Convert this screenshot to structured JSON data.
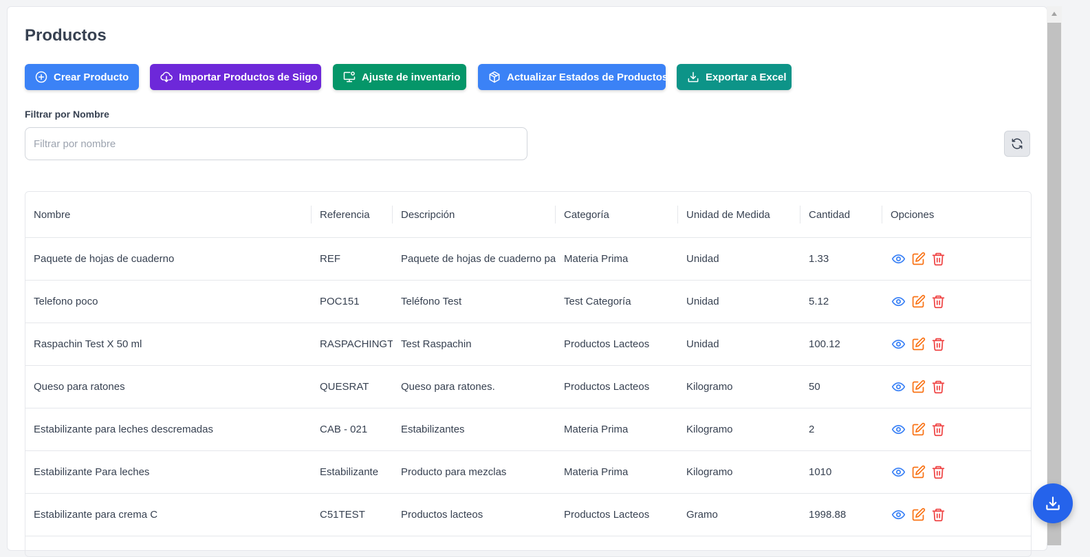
{
  "page": {
    "title": "Productos"
  },
  "toolbar": {
    "buttons": [
      {
        "label": "Crear Producto",
        "icon": "plus-circle-icon",
        "color": "#3b82f6"
      },
      {
        "label": "Importar Productos de Siigo",
        "icon": "cloud-download-icon",
        "color": "#6d28d9"
      },
      {
        "label": "Ajuste de inventario",
        "icon": "monitor-settings-icon",
        "color": "#059669"
      },
      {
        "label": "Actualizar Estados de Productos",
        "icon": "package-icon",
        "color": "#3b82f6"
      },
      {
        "label": "Exportar a Excel",
        "icon": "download-icon",
        "color": "#0d9488"
      }
    ]
  },
  "filter": {
    "label": "Filtrar por Nombre",
    "placeholder": "Filtrar por nombre",
    "value": ""
  },
  "table": {
    "headers": [
      "Nombre",
      "Referencia",
      "Descripción",
      "Categoría",
      "Unidad de Medida",
      "Cantidad",
      "Opciones"
    ],
    "rows": [
      [
        "Paquete de hojas de cuaderno",
        "REF",
        "Paquete de hojas de cuaderno para",
        "Materia Prima",
        "Unidad",
        "1.33"
      ],
      [
        "Telefono poco",
        "POC151",
        "Teléfono Test",
        "Test Categoría",
        "Unidad",
        "5.12"
      ],
      [
        "Raspachin Test X 50 ml",
        "RASPACHINGTEST",
        "Test Raspachin",
        "Productos Lacteos",
        "Unidad",
        "100.12"
      ],
      [
        "Queso para ratones",
        "QUESRAT",
        "Queso para ratones.",
        "Productos Lacteos",
        "Kilogramo",
        "50"
      ],
      [
        "Estabilizante para leches descremadas",
        "CAB - 021",
        "Estabilizantes",
        "Materia Prima",
        "Kilogramo",
        "2"
      ],
      [
        "Estabilizante Para leches",
        "Estabilizante",
        "Producto para mezclas",
        "Materia Prima",
        "Kilogramo",
        "1010"
      ],
      [
        "Estabilizante para crema C",
        "C51TEST",
        "Productos lacteos",
        "Productos Lacteos",
        "Gramo",
        "1998.88"
      ]
    ],
    "action_icons": [
      "eye-icon",
      "edit-icon",
      "trash-icon"
    ],
    "action_colors": {
      "view": "#3b82f6",
      "edit": "#f97316",
      "delete": "#ef4444"
    }
  },
  "fab": {
    "icon": "download-icon",
    "color": "#2563eb"
  }
}
